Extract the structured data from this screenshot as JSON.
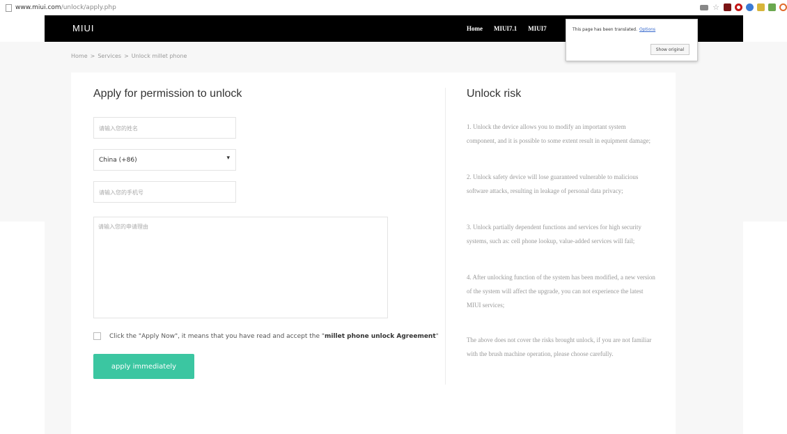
{
  "browser": {
    "url_host": "www.miui.com",
    "url_path": "/unlock/apply.php",
    "colors": {
      "ext_red": "#c41616",
      "ext_gray": "#888888",
      "ext_blue": "#3a7bd5",
      "ext_yellow": "#d7b53a",
      "ext_green": "#6aa84f",
      "ext_orange": "#e06a2b"
    }
  },
  "header": {
    "logo": "MIUI",
    "nav": [
      "Home",
      "MIUI7.1",
      "MIUI7"
    ]
  },
  "translate_popup": {
    "message": "This page has been translated.",
    "options_label": "Options",
    "show_original_label": "Show original"
  },
  "breadcrumb": {
    "items": [
      "Home",
      "Services",
      "Unlock millet phone"
    ],
    "separator": ">"
  },
  "form": {
    "title": "Apply for permission to unlock",
    "name_placeholder": "请输入您的姓名",
    "country_value": "China (+86)",
    "phone_placeholder": "请输入您的手机号",
    "reason_placeholder": "请输入您的申请理由",
    "agreement_text_prefix": "Click the \"Apply Now\", it means that you have read and accept the \"",
    "agreement_link": "millet phone unlock Agreement",
    "agreement_text_suffix": "\"",
    "apply_button": "apply immediately",
    "accent_color": "#3bc6a1"
  },
  "risk": {
    "title": "Unlock risk",
    "items": [
      "1. Unlock the device allows you to modify an important system component, and it is possible to some extent result in equipment damage;",
      "2. Unlock safety device will lose guaranteed vulnerable to malicious software attacks, resulting in leakage of personal data privacy;",
      "3. Unlock partially dependent functions and services for high security systems, such as: cell phone lookup, value-added services will fail;",
      "4. After unlocking function of the system has been modified, a new version of the system will affect the upgrade, you can not experience the latest MIUI services;",
      "The above does not cover the risks brought unlock, if you are not familiar with the brush machine operation, please choose carefully."
    ]
  }
}
